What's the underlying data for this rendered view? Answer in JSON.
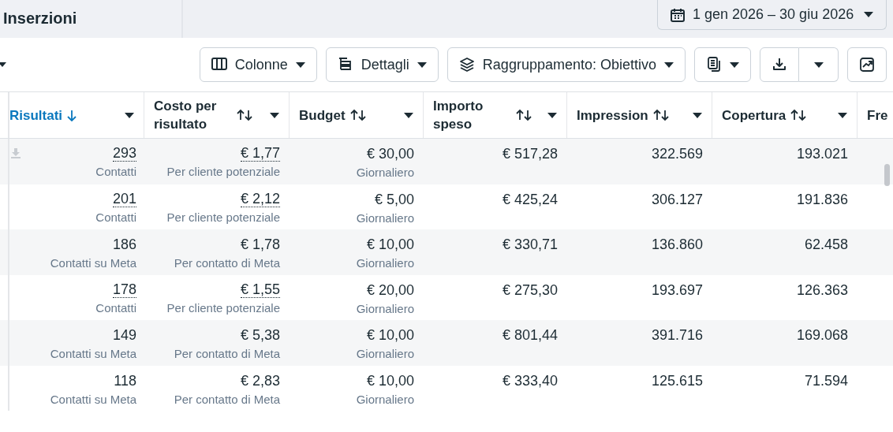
{
  "tab": {
    "label": "Inserzioni"
  },
  "date_range": {
    "label": "1 gen 2026 – 30 giu 2026"
  },
  "toolbar": [
    {
      "kind": "menu",
      "label": "Colonne"
    },
    {
      "kind": "menu",
      "label": "Dettagli"
    },
    {
      "kind": "menu",
      "label": "Raggruppamento: Obiettivo"
    },
    {
      "kind": "icon-menu"
    },
    {
      "kind": "split"
    },
    {
      "kind": "icon"
    }
  ],
  "table": {
    "columns": [
      {
        "label": "Risultati",
        "sorted": true
      },
      {
        "label": "Costo per risultato",
        "sorted": false
      },
      {
        "label": "Budget",
        "sorted": false
      },
      {
        "label": "Importo speso",
        "sorted": false
      },
      {
        "label": "Impression",
        "sorted": false
      },
      {
        "label": "Copertura",
        "sorted": false
      },
      {
        "label": "Fre"
      }
    ],
    "rows": [
      {
        "results": "293",
        "result_type": "Contatti",
        "cost": "€ 1,77",
        "cost_type": "Per cliente potenziale",
        "budget": "€ 30,00",
        "budget_type": "Giornaliero",
        "spent": "€ 517,28",
        "impressions": "322.569",
        "reach": "193.021",
        "linked": true,
        "hovered": true
      },
      {
        "results": "201",
        "result_type": "Contatti",
        "cost": "€ 2,12",
        "cost_type": "Per cliente potenziale",
        "budget": "€ 5,00",
        "budget_type": "Giornaliero",
        "spent": "€ 425,24",
        "impressions": "306.127",
        "reach": "191.836",
        "linked": true,
        "hovered": false
      },
      {
        "results": "186",
        "result_type": "Contatti su Meta",
        "cost": "€ 1,78",
        "cost_type": "Per contatto di Meta",
        "budget": "€ 10,00",
        "budget_type": "Giornaliero",
        "spent": "€ 330,71",
        "impressions": "136.860",
        "reach": "62.458",
        "linked": false,
        "hovered": false
      },
      {
        "results": "178",
        "result_type": "Contatti",
        "cost": "€ 1,55",
        "cost_type": "Per cliente potenziale",
        "budget": "€ 20,00",
        "budget_type": "Giornaliero",
        "spent": "€ 275,30",
        "impressions": "193.697",
        "reach": "126.363",
        "linked": true,
        "hovered": false
      },
      {
        "results": "149",
        "result_type": "Contatti su Meta",
        "cost": "€ 5,38",
        "cost_type": "Per contatto di Meta",
        "budget": "€ 10,00",
        "budget_type": "Giornaliero",
        "spent": "€ 801,44",
        "impressions": "391.716",
        "reach": "169.068",
        "linked": false,
        "hovered": false
      },
      {
        "results": "118",
        "result_type": "Contatti su Meta",
        "cost": "€ 2,83",
        "cost_type": "Per contatto di Meta",
        "budget": "€ 10,00",
        "budget_type": "Giornaliero",
        "spent": "€ 333,40",
        "impressions": "125.615",
        "reach": "71.594",
        "linked": false,
        "hovered": false
      }
    ]
  }
}
